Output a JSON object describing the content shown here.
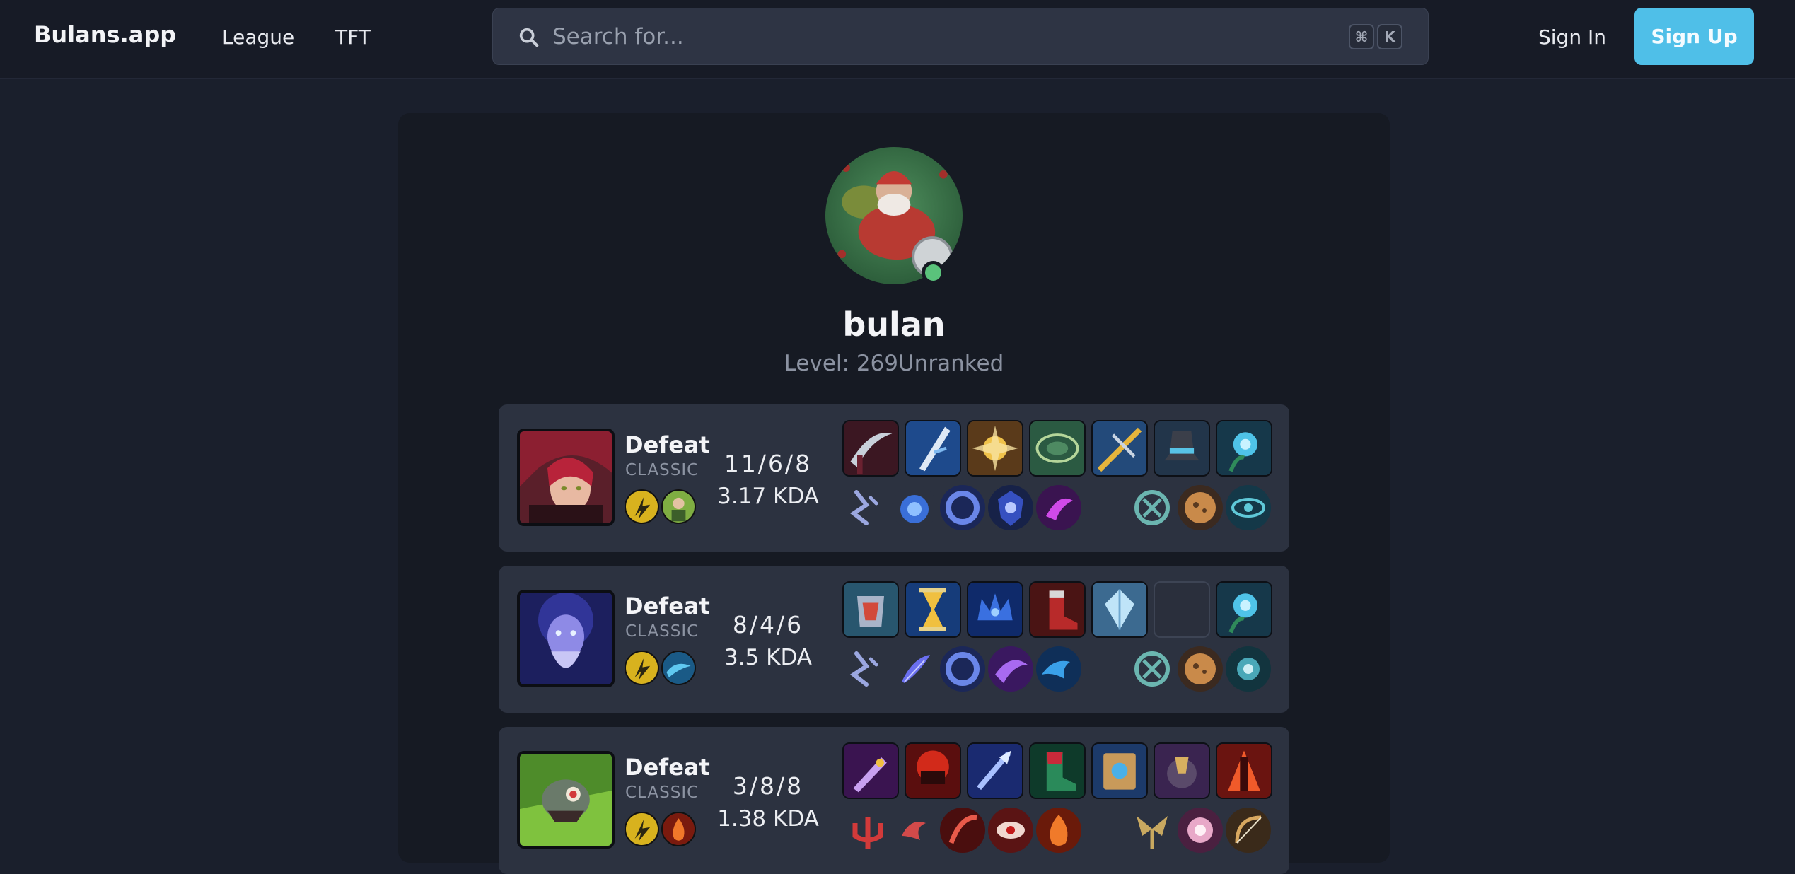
{
  "header": {
    "logo": "Bulans.app",
    "nav": [
      "League",
      "TFT"
    ],
    "search_placeholder": "Search for...",
    "shortcut_keys": [
      "⌘",
      "K"
    ],
    "sign_in": "Sign In",
    "sign_up": "Sign Up"
  },
  "profile": {
    "name": "bulan",
    "level_label": "Level: ",
    "level": "269",
    "rank": "Unranked",
    "online": true
  },
  "colors": {
    "background": "#1a1f2c",
    "card": "#161a23",
    "match_row": "#2c3240",
    "accent": "#4fbfe8",
    "online": "#5ac27b"
  },
  "matches": [
    {
      "result": "Defeat",
      "mode": "CLASSIC",
      "champion_icon": "fiery-red-haired-champion",
      "spells": [
        "flash-spell",
        "summon-spell"
      ],
      "kda": "11/6/8",
      "kda_ratio": "3.17 KDA",
      "items": [
        "scythe-item",
        "blade-item",
        "golden-orb-item",
        "green-runes-item",
        "crossbow-item",
        "hat-item",
        "ward-orb-item"
      ],
      "runes": [
        "lethal-tempo-rune",
        "spirit-rune",
        "ring-rune",
        "shield-orb-rune",
        "purple-storm-rune"
      ],
      "secondary": [
        "teal-rune-a",
        "cookie-rune",
        "eye-rune"
      ]
    },
    {
      "result": "Defeat",
      "mode": "CLASSIC",
      "champion_icon": "purple-wizard-champion",
      "spells": [
        "flash-spell",
        "cleanse-spell"
      ],
      "kda": "8/4/6",
      "kda_ratio": "3.5 KDA",
      "items": [
        "frost-armor-item",
        "hourglass-item",
        "blue-crown-item",
        "red-boots-item",
        "ice-crystal-item",
        "",
        "ward-orb-item"
      ],
      "runes": [
        "lethal-tempo-rune",
        "feather-rune",
        "ring-rune",
        "purple-storm-rune",
        "wave-rune"
      ],
      "secondary": [
        "teal-rune-a",
        "cookie-rune",
        "teal-orb-rune"
      ]
    },
    {
      "result": "Defeat",
      "mode": "CLASSIC",
      "champion_icon": "green-rat-champion",
      "spells": [
        "flash-spell",
        "ignite-spell"
      ],
      "kda": "3/8/8",
      "kda_ratio": "1.38 KDA",
      "items": [
        "purple-dagger-item",
        "red-helmet-item",
        "blue-lance-item",
        "green-boots-item",
        "spellbook-item",
        "dark-cannon-item",
        "lava-tower-item"
      ],
      "runes": [
        "red-trident-rune",
        "red-swirl-rune",
        "red-claw-rune",
        "red-eye-rune",
        "fire-rune"
      ],
      "secondary": [
        "gold-wings-rune",
        "pink-orb-rune",
        "bow-rune"
      ]
    }
  ]
}
